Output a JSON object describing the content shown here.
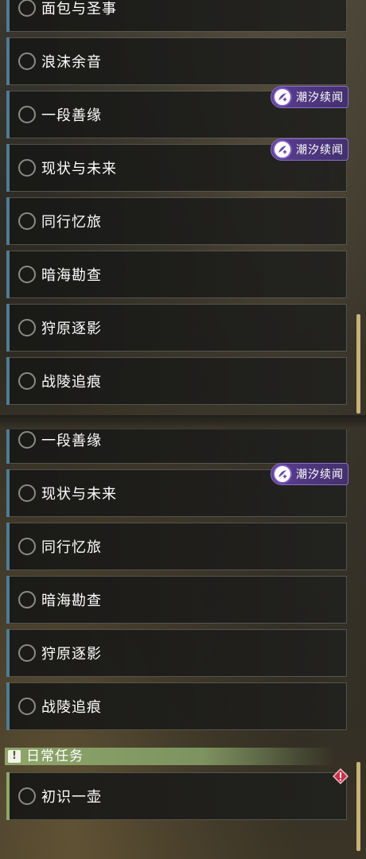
{
  "panel_top": {
    "quests": [
      {
        "label": "面包与圣事"
      },
      {
        "label": "浪沫余音"
      },
      {
        "label": "一段善缘"
      },
      {
        "label": "现状与未来"
      },
      {
        "label": "同行忆旅"
      },
      {
        "label": "暗海勘查"
      },
      {
        "label": "狩原逐影"
      },
      {
        "label": "战陵追痕"
      }
    ],
    "badges": [
      {
        "text": "潮汐续闻",
        "icon": "tide-spark-icon"
      },
      {
        "text": "潮汐续闻",
        "icon": "tide-spark-icon"
      }
    ]
  },
  "panel_bottom": {
    "quests": [
      {
        "label": "一段善缘"
      },
      {
        "label": "现状与未来"
      },
      {
        "label": "同行忆旅"
      },
      {
        "label": "暗海勘查"
      },
      {
        "label": "狩原逐影"
      },
      {
        "label": "战陵追痕"
      }
    ],
    "badges": [
      {
        "text": "潮汐续闻",
        "icon": "tide-spark-icon"
      }
    ],
    "section": {
      "title": "日常任务",
      "icon": "exclamation-icon"
    },
    "daily_quests": [
      {
        "label": "初识一壶",
        "alert_icon": "warning-diamond-icon"
      }
    ]
  },
  "colors": {
    "quest_accent": "#4f7c93",
    "daily_accent": "#8fa66a",
    "badge_purple": "#5b3e91",
    "scrollbar": "#c7b277",
    "alert_red": "#c8324a"
  }
}
